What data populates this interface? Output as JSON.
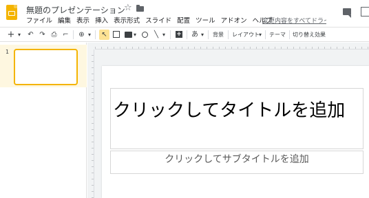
{
  "app": {
    "document_title": "無題のプレゼンテーション",
    "star_glyph": "☆",
    "changes_link": "変更内容をすべてドライブに保存しました"
  },
  "menu": [
    "ファイル",
    "編集",
    "表示",
    "挿入",
    "表示形式",
    "スライド",
    "配置",
    "ツール",
    "アドオン",
    "ヘルプ"
  ],
  "toolbar": {
    "new_slide": "+",
    "dropdown_arrow": "▾",
    "undo": "↶",
    "redo": "↷",
    "print": "⎙",
    "paint_format": "⌐",
    "zoom": "⊕",
    "select": "↖",
    "line": "╲",
    "font_glyph": "あ",
    "background": "背景",
    "layout": "レイアウト",
    "layout_arrow": "▾",
    "theme": "テーマ",
    "transition": "切り替え効果"
  },
  "filmstrip": {
    "slides": [
      {
        "number": "1"
      }
    ]
  },
  "slide": {
    "title_placeholder": "クリックしてタイトルを追加",
    "subtitle_placeholder": "クリックしてサブタイトルを追加"
  },
  "colors": {
    "brand": "#f4b400",
    "selection_bg": "#fef7e0",
    "active_tool": "#fde293"
  }
}
